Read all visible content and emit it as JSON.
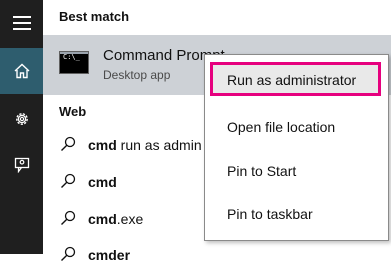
{
  "rail": {
    "items": [
      {
        "icon": "hamburger-menu-icon"
      },
      {
        "icon": "home-icon",
        "active": true
      },
      {
        "icon": "settings-gear-icon"
      },
      {
        "icon": "feedback-person-icon"
      }
    ]
  },
  "search": {
    "best_match_heading": "Best match",
    "best_match": {
      "title": "Command Prompt",
      "subtitle": "Desktop app",
      "icon": "command-prompt-icon"
    },
    "web_heading": "Web",
    "web_results": [
      {
        "bold": "cmd",
        "rest": " run as admin"
      },
      {
        "bold": "cmd",
        "rest": ""
      },
      {
        "bold": "cmd",
        "rest": ".exe"
      },
      {
        "bold": "cmder",
        "rest": ""
      }
    ]
  },
  "context_menu": {
    "items": [
      {
        "label": "Run as administrator",
        "highlighted": true
      },
      {
        "label": "Open file location"
      },
      {
        "label": "Pin to Start"
      },
      {
        "label": "Pin to taskbar"
      }
    ],
    "highlight_color": "#e6007e"
  },
  "colors": {
    "rail": "#1f1f1f",
    "rail_active": "#2e5d6e",
    "best_match_bg": "#cdd1d6"
  }
}
